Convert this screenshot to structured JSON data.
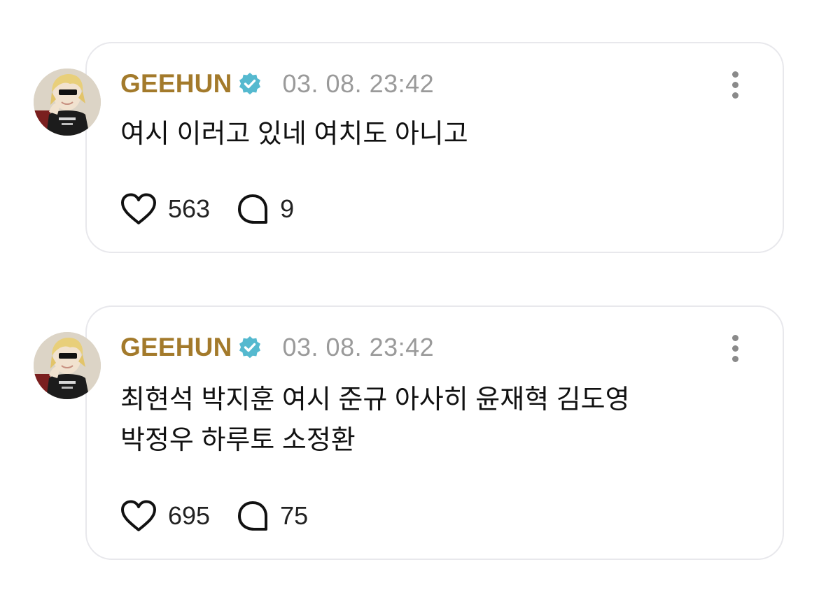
{
  "posts": [
    {
      "username": "GEEHUN",
      "timestamp": "03. 08. 23:42",
      "text": "여시 이러고 있네 여치도 아니고",
      "likes": "563",
      "replies": "9"
    },
    {
      "username": "GEEHUN",
      "timestamp": "03. 08. 23:42",
      "text": "최현석 박지훈 여시 준규 아사히 윤재혁 김도영\n박정우 하루토 소정환",
      "likes": "695",
      "replies": "75"
    }
  ],
  "icons": {
    "verified": "verified-badge-icon",
    "more": "more-vertical-icon",
    "like": "heart-icon",
    "reply": "speech-bubble-icon"
  },
  "colors": {
    "username": "#a37a2b",
    "verified_badge": "#55b9cf",
    "timestamp": "#9a9a9a",
    "card_border": "#e8e8ec"
  }
}
